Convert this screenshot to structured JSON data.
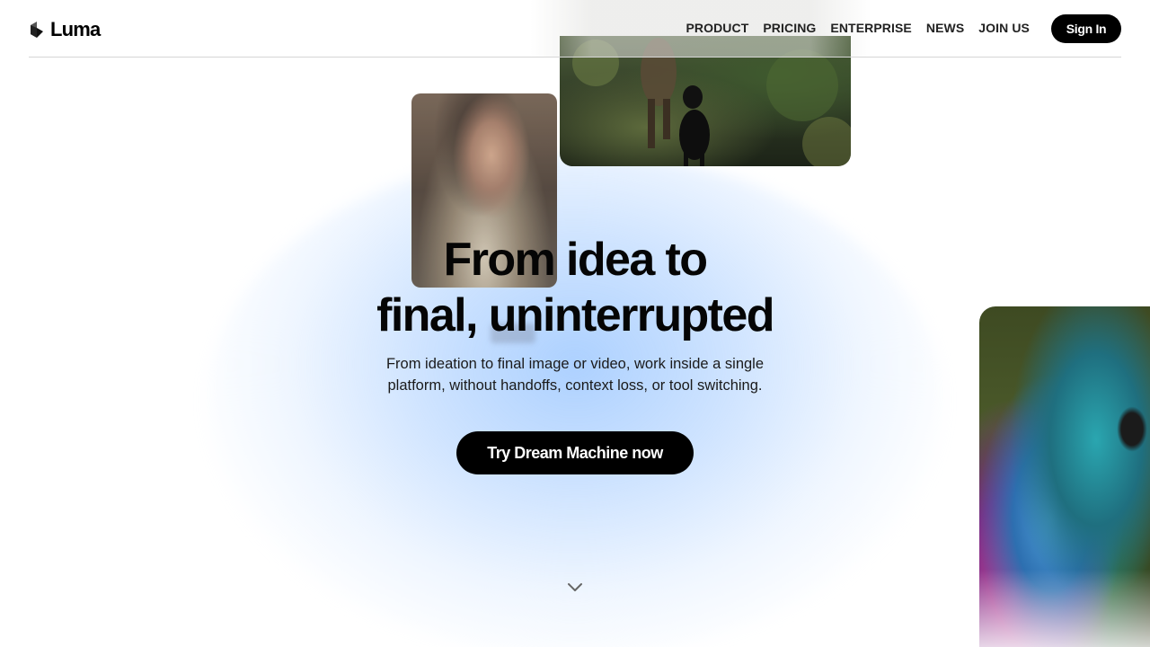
{
  "header": {
    "logo_text": "Luma",
    "nav": [
      "PRODUCT",
      "PRICING",
      "ENTERPRISE",
      "NEWS",
      "JOIN US"
    ],
    "signin_label": "Sign In"
  },
  "hero": {
    "title_line1": "From idea to",
    "title_line2": "final, uninterrupted",
    "subtitle_line1": "From ideation to final image or video, work inside a single",
    "subtitle_line2": "platform, without handoffs, context loss, or tool switching.",
    "cta_label": "Try Dream Machine now"
  },
  "icons": {
    "logo": "luma-logo-icon",
    "scroll": "chevron-down-icon"
  }
}
